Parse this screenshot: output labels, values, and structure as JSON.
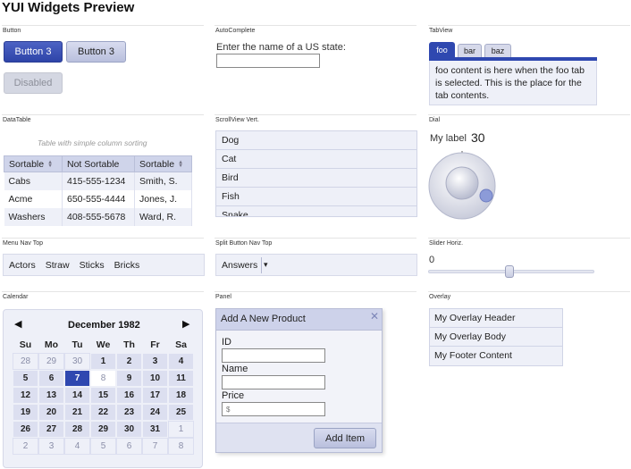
{
  "page": {
    "title": "YUI Widgets Preview"
  },
  "sections": {
    "button": "Button",
    "autocomplete": "AutoComplete",
    "tabview": "TabView",
    "datatable": "DataTable",
    "scrollview": "ScrollView Vert.",
    "dial": "Dial",
    "menunav": "Menu Nav Top",
    "splitbutton": "Split Button Nav Top",
    "slider": "Slider Horiz.",
    "calendar": "Calendar",
    "panel": "Panel",
    "overlay": "Overlay"
  },
  "button": {
    "primary_label": "Button 3",
    "normal_label": "Button 3",
    "disabled_label": "Disabled"
  },
  "autocomplete": {
    "label": "Enter the name of a US state:",
    "value": ""
  },
  "tabview": {
    "tabs": [
      "foo",
      "bar",
      "baz"
    ],
    "active": "foo",
    "content": "foo content is here when the foo tab is selected. This is the place for the tab contents."
  },
  "datatable": {
    "caption": "Table with simple column sorting",
    "columns": [
      "Sortable",
      "Not Sortable",
      "Sortable"
    ],
    "rows": [
      [
        "Cabs",
        "415-555-1234",
        "Smith, S."
      ],
      [
        "Acme",
        "650-555-4444",
        "Jones, J."
      ],
      [
        "Washers",
        "408-555-5678",
        "Ward, R."
      ]
    ]
  },
  "scrollview": {
    "items": [
      "Dog",
      "Cat",
      "Bird",
      "Fish",
      "Snake"
    ]
  },
  "dial": {
    "label": "My label",
    "value": "30"
  },
  "menunav": {
    "items": [
      "Actors",
      "Straw",
      "Sticks",
      "Bricks"
    ]
  },
  "splitbutton": {
    "label": "Answers",
    "arrow": "▾"
  },
  "slider": {
    "value_text": "0",
    "value": 0.49
  },
  "calendar": {
    "month": "December 1982",
    "prev": "◀",
    "next": "▶",
    "dow": [
      "Su",
      "Mo",
      "Tu",
      "We",
      "Th",
      "Fr",
      "Sa"
    ],
    "weeks": [
      [
        "28",
        "29",
        "30",
        "1",
        "2",
        "3",
        "4"
      ],
      [
        "5",
        "6",
        "7",
        "8",
        "9",
        "10",
        "11"
      ],
      [
        "12",
        "13",
        "14",
        "15",
        "16",
        "17",
        "18"
      ],
      [
        "19",
        "20",
        "21",
        "22",
        "23",
        "24",
        "25"
      ],
      [
        "26",
        "27",
        "28",
        "29",
        "30",
        "31",
        "1"
      ],
      [
        "2",
        "3",
        "4",
        "5",
        "6",
        "7",
        "8"
      ]
    ],
    "selected": "7",
    "highlight": "8"
  },
  "panel": {
    "title": "Add A New Product",
    "close": "✕",
    "fields": [
      {
        "label": "ID",
        "value": ""
      },
      {
        "label": "Name",
        "value": ""
      },
      {
        "label": "Price",
        "placeholder": "$"
      }
    ],
    "submit": "Add Item"
  },
  "overlay": {
    "header": "My Overlay Header",
    "body": "My Overlay Body",
    "footer": "My Footer Content"
  },
  "colors": {
    "accent": "#2f48b0",
    "panel_bg": "#eef0f8"
  }
}
